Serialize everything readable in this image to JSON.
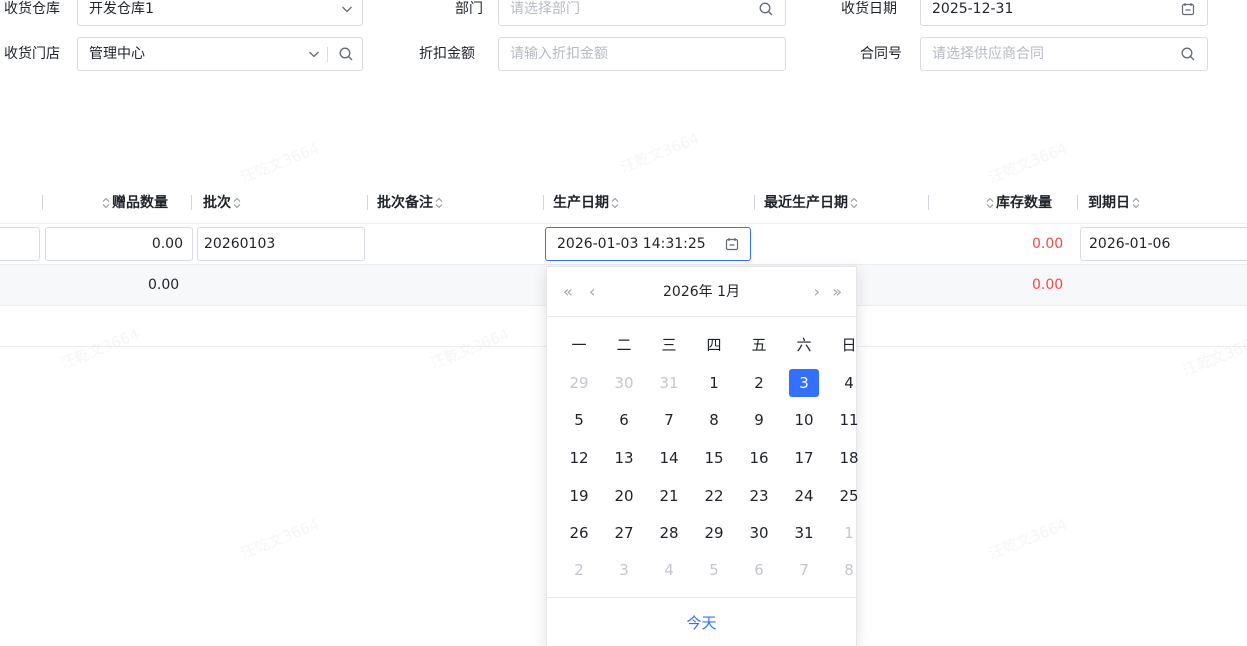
{
  "form": {
    "warehouse_label": "收货仓库",
    "warehouse_value": "开发仓库1",
    "dept_label": "部门",
    "dept_placeholder": "请选择部门",
    "receive_date_label": "收货日期",
    "receive_date_value": "2025-12-31",
    "store_label": "收货门店",
    "store_value": "管理中心",
    "discount_label": "折扣金额",
    "discount_placeholder": "请输入折扣金额",
    "contract_label": "合同号",
    "contract_placeholder": "请选择供应商合同"
  },
  "table": {
    "headers": {
      "gift_qty": "赠品数量",
      "batch": "批次",
      "batch_note": "批次备注",
      "prod_date": "生产日期",
      "recent_prod_date": "最近生产日期",
      "stock_qty": "库存数量",
      "expiry": "到期日"
    },
    "row1": {
      "gift_qty": "0.00",
      "batch": "20260103",
      "prod_date": "2026-01-03 14:31:25",
      "stock_qty": "0.00",
      "expiry": "2026-01-06"
    },
    "row2": {
      "gift_qty": "0.00",
      "stock_qty": "0.00"
    }
  },
  "datepicker": {
    "nav_prev_year": "«",
    "nav_prev_month": "‹",
    "nav_next_month": "›",
    "nav_next_year": "»",
    "title": "2026年 1月",
    "weekdays": [
      "一",
      "二",
      "三",
      "四",
      "五",
      "六",
      "日"
    ],
    "weeks": [
      [
        "29",
        "30",
        "31",
        "1",
        "2",
        "3",
        "4"
      ],
      [
        "5",
        "6",
        "7",
        "8",
        "9",
        "10",
        "11"
      ],
      [
        "12",
        "13",
        "14",
        "15",
        "16",
        "17",
        "18"
      ],
      [
        "19",
        "20",
        "21",
        "22",
        "23",
        "24",
        "25"
      ],
      [
        "26",
        "27",
        "28",
        "29",
        "30",
        "31",
        "1"
      ],
      [
        "2",
        "3",
        "4",
        "5",
        "6",
        "7",
        "8"
      ]
    ],
    "muted_leading": 3,
    "muted_trailing": 8,
    "selected_day": "3",
    "today_label": "今天"
  },
  "watermark": "汪乾文3664",
  "icons": {
    "chevron": "chevron-down-icon",
    "search": "search-icon",
    "calendar": "calendar-icon",
    "sort": "sort-icon"
  },
  "colors": {
    "accent": "#3370ff",
    "negative": "#f54a45",
    "placeholder": "#b6bac2"
  }
}
